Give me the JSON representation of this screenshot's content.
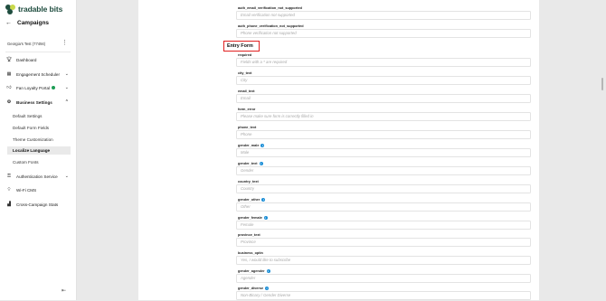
{
  "brand": {
    "name": "tradable bits"
  },
  "sidebar": {
    "back_label": "Campaigns",
    "account_name": "Georgia's Test (77494)",
    "nav": [
      {
        "label": "Dashboard",
        "icon": "trophy-icon"
      },
      {
        "label": "Engagement Scheduler",
        "icon": "calendar-icon"
      },
      {
        "label": "Fan Loyalty Portal",
        "icon": "thumbs-up-icon"
      },
      {
        "label": "Business Settings",
        "icon": "settings-icon"
      },
      {
        "label": "Authentication Service",
        "icon": "key-icon"
      },
      {
        "label": "Wi-Fi CMS",
        "icon": "wifi-icon"
      },
      {
        "label": "Cross-Campaign Stats",
        "icon": "bar-chart-icon"
      }
    ],
    "business_sub": [
      {
        "label": "Default Settings"
      },
      {
        "label": "Default Form Fields"
      },
      {
        "label": "Theme Customization"
      },
      {
        "label": "Localize Language"
      },
      {
        "label": "Custom Fonts"
      }
    ]
  },
  "fields_top": [
    {
      "label": "auth_email_verification_not_supported",
      "value": "Email verification not supported"
    },
    {
      "label": "auth_phone_verification_not_supported",
      "value": "Phone verification not supported"
    }
  ],
  "section_title": "Entry Form",
  "fields": [
    {
      "label": "required",
      "value": "Fields with a * are required"
    },
    {
      "label": "city_text",
      "value": "City"
    },
    {
      "label": "email_text",
      "value": "Email"
    },
    {
      "label": "form_error",
      "value": "Please make sure form is correctly filled in"
    },
    {
      "label": "phone_text",
      "value": "Phone"
    },
    {
      "label": "gender_male",
      "value": "Male"
    },
    {
      "label": "gender_text",
      "value": "Gender"
    },
    {
      "label": "country_text",
      "value": "Country"
    },
    {
      "label": "gender_other",
      "value": "Other"
    },
    {
      "label": "gender_female",
      "value": "Female"
    },
    {
      "label": "province_text",
      "value": "Province"
    },
    {
      "label": "business_optin",
      "value": "Yes, I would like to subscribe"
    },
    {
      "label": "gender_agender",
      "value": "Agender"
    },
    {
      "label": "gender_diverse",
      "value": "Non-Binary / Gender Diverse"
    }
  ]
}
